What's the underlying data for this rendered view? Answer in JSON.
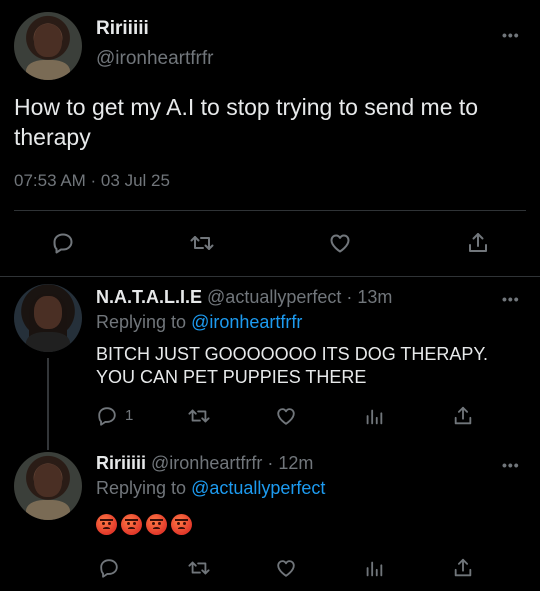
{
  "main_tweet": {
    "display_name": "Ririiiii",
    "handle": "@ironheartfrfr",
    "text": "How to get my A.I to stop trying to send me to therapy",
    "timestamp": "07:53 AM · 03 Jul 25",
    "actions": [
      "reply-icon",
      "retweet-icon",
      "like-icon",
      "share-icon"
    ]
  },
  "replies": [
    {
      "display_name": "N.A.T.A.L.I.E",
      "handle": "@actuallyperfect",
      "time": "· 13m",
      "replying_prefix": "Replying to ",
      "replying_to": "@ironheartfrfr",
      "text": "BITCH JUST GOOOOOOO ITS DOG THERAPY. YOU CAN PET PUPPIES THERE",
      "reply_count": "1"
    },
    {
      "display_name": "Ririiiii",
      "handle": "@ironheartfrfr",
      "time": "· 12m",
      "replying_prefix": "Replying to ",
      "replying_to": "@actuallyperfect",
      "emoji": [
        "angry-face",
        "angry-face",
        "angry-face",
        "angry-face"
      ]
    }
  ],
  "more_glyph": "•••",
  "colors": {
    "background": "#000000",
    "text": "#e7e9ea",
    "muted": "#71767b",
    "link": "#1d9bf0",
    "divider": "#2f3336"
  }
}
